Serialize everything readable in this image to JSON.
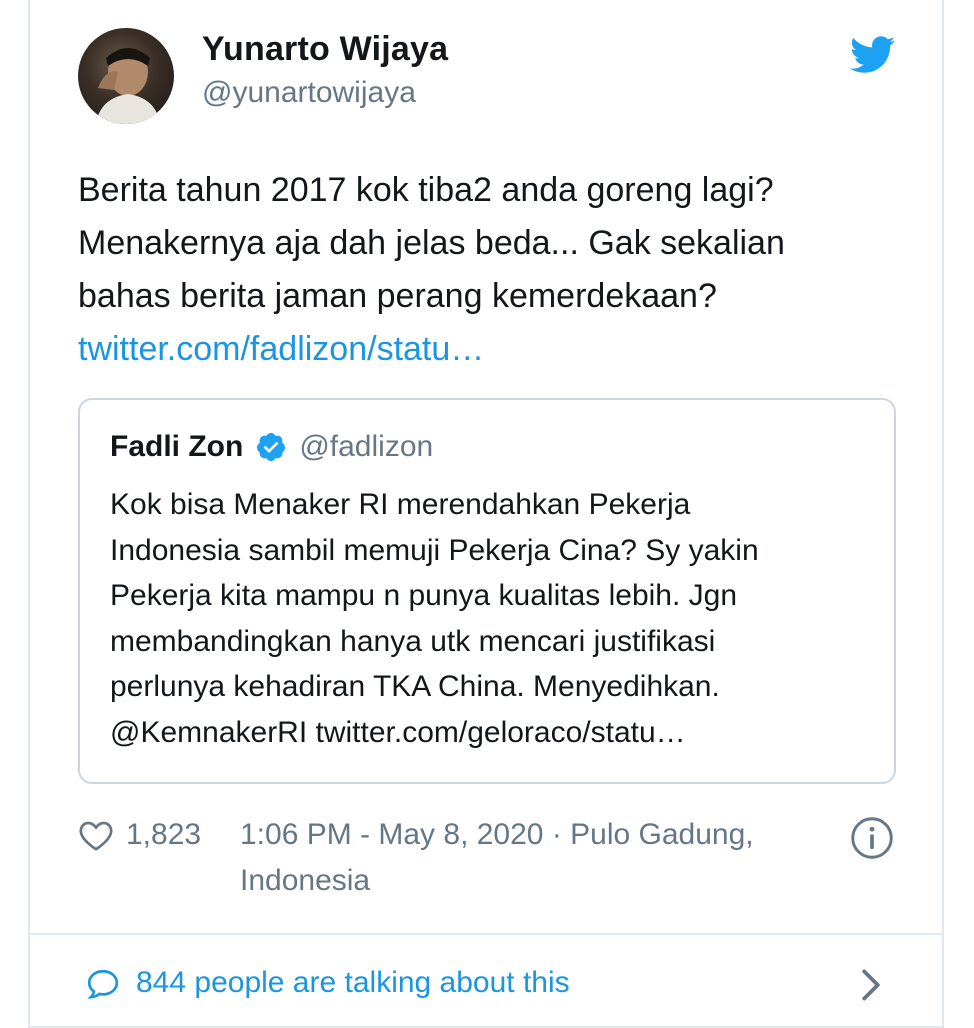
{
  "author": {
    "display_name": "Yunarto Wijaya",
    "handle": "@yunartowijaya"
  },
  "tweet": {
    "text_lines": [
      "Berita tahun 2017 kok tiba2 anda goreng lagi?",
      "Menakernya aja dah jelas beda... Gak sekalian",
      "bahas berita jaman perang kemerdekaan?"
    ],
    "link": "twitter.com/fadlizon/statu…"
  },
  "quoted_tweet": {
    "display_name": "Fadli Zon",
    "handle": "@fadlizon",
    "text_lines": [
      "Kok bisa Menaker RI merendahkan Pekerja",
      "Indonesia sambil memuji Pekerja Cina? Sy yakin",
      "Pekerja kita mampu n punya kualitas lebih.  Jgn",
      "membandingkan hanya utk mencari justifikasi",
      "perlunya kehadiran TKA China. Menyedihkan.",
      "@KemnakerRI twitter.com/geloraco/statu…"
    ]
  },
  "meta": {
    "like_count": "1,823",
    "timestamp_line1": "1:06 PM - May 8, 2020 · Pulo Gadung,",
    "timestamp_line2": "Indonesia"
  },
  "footer": {
    "talking_text": "844 people are talking about this"
  },
  "icons": {
    "brand": "twitter-bird-icon",
    "verified": "verified-badge-icon",
    "like": "heart-icon",
    "info": "info-icon",
    "conversation": "speech-bubble-icon",
    "chevron": "chevron-right-icon"
  },
  "colors": {
    "brand_blue": "#1da1f2",
    "link_blue": "#1b95e0",
    "text": "#14171a",
    "secondary": "#657786",
    "border": "#e1e8ed"
  }
}
